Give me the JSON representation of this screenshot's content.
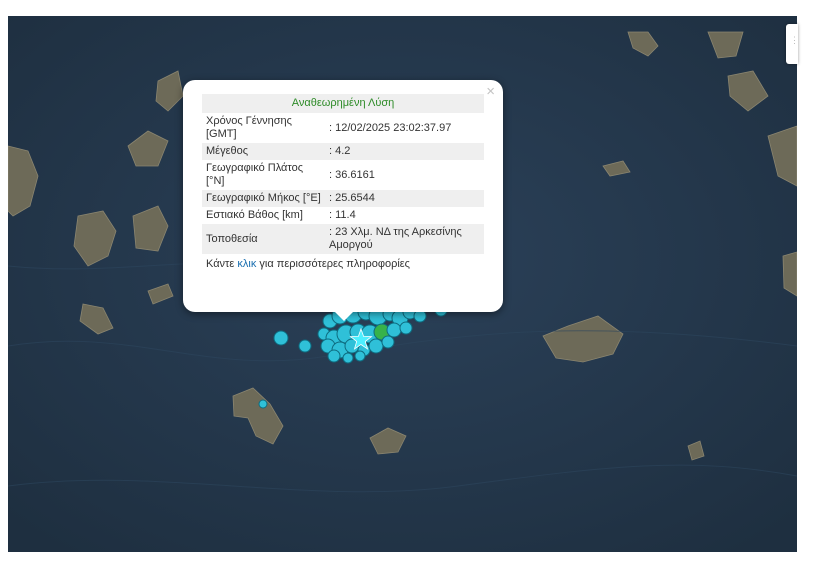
{
  "popup": {
    "title": "Αναθεωρημένη Λύση",
    "close_glyph": "×",
    "rows": [
      {
        "label": "Χρόνος Γέννησης [GMT]",
        "value": ": 12/02/2025 23:02:37.97"
      },
      {
        "label": "Μέγεθος",
        "value": ": 4.2"
      },
      {
        "label": "Γεωγραφικό Πλάτος [°N]",
        "value": ": 36.6161"
      },
      {
        "label": "Γεωγραφικό Μήκος [°E]",
        "value": ": 25.6544"
      },
      {
        "label": "Εστιακό Βάθος [km]",
        "value": ": 11.4"
      },
      {
        "label": "Τοποθεσία",
        "value": ": 23 Χλμ. ΝΔ της Αρκεσίνης Αμοργού"
      }
    ],
    "more_prefix": "Κάντε ",
    "more_link": "κλικ",
    "more_suffix": " για περισσότερες πληροφορίες"
  },
  "map_colors": {
    "sea": "#23364a",
    "land": "#6d6a58",
    "marker_fill": "#2fc0d8",
    "marker_stroke": "#0e6c80",
    "marker_old": "#37b24a",
    "star": "#4ef0ff"
  },
  "icons": {
    "epicenter": "star-icon",
    "close": "close-icon"
  }
}
